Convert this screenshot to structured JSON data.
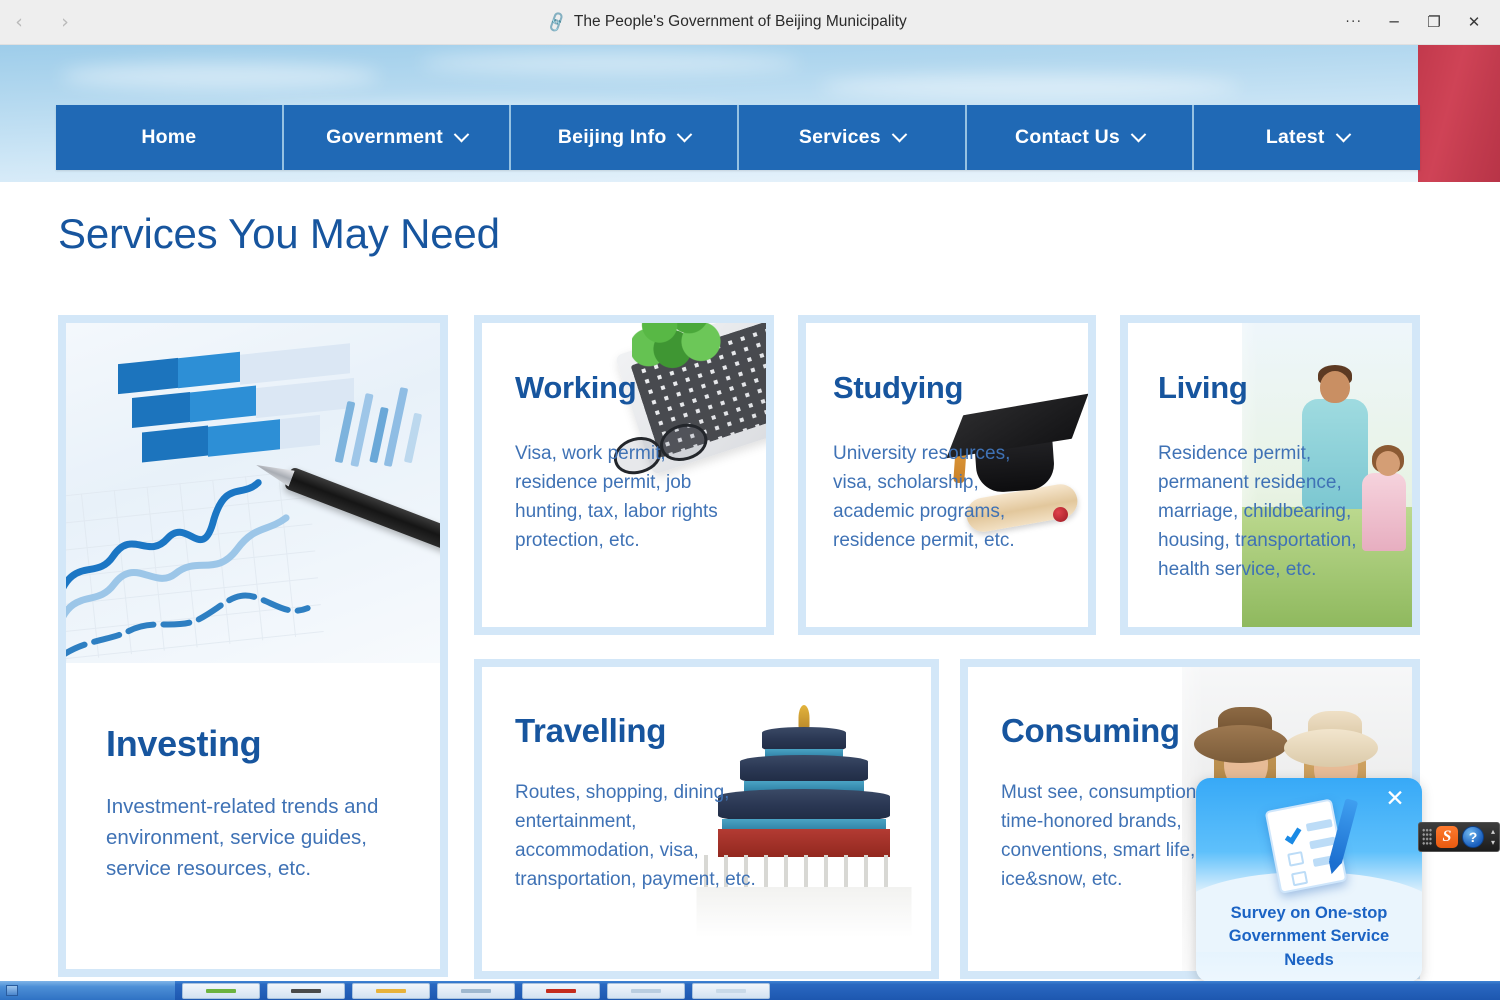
{
  "browser": {
    "title": "The People's Government of Beijing Municipality",
    "back_label": "‹",
    "forward_label": "›",
    "more_label": "···",
    "minimize_label": "─",
    "restore_label": "❐",
    "close_label": "✕",
    "paperclip_icon": "🖇"
  },
  "nav": {
    "items": [
      {
        "label": "Home",
        "has_caret": false
      },
      {
        "label": "Government",
        "has_caret": true
      },
      {
        "label": "Beijing Info",
        "has_caret": true
      },
      {
        "label": "Services",
        "has_caret": true
      },
      {
        "label": "Contact Us",
        "has_caret": true
      },
      {
        "label": "Latest",
        "has_caret": true
      }
    ]
  },
  "page": {
    "section_title": "Services You May Need"
  },
  "cards": [
    {
      "id": "investing",
      "title": "Investing",
      "desc": "Investment-related trends and environment, service guides, service resources, etc."
    },
    {
      "id": "working",
      "title": "Working",
      "desc": "Visa, work permit, residence permit, job hunting, tax, labor rights protection, etc."
    },
    {
      "id": "studying",
      "title": "Studying",
      "desc": "University resources, visa, scholarship, academic programs, residence permit, etc."
    },
    {
      "id": "living",
      "title": "Living",
      "desc": "Residence permit, permanent residence, marriage, childbearing, housing, transportation, health service, etc."
    },
    {
      "id": "travelling",
      "title": "Travelling",
      "desc": "Routes, shopping, dining, entertainment, accommodation, visa, transportation, payment, etc."
    },
    {
      "id": "consuming",
      "title": "Consuming",
      "desc": "Must see, consumption seasons, time-honored brands, conventions, smart life, ice&snow, etc."
    }
  ],
  "survey_popup": {
    "text": "Survey on One-stop Government Service Needs",
    "close_label": "✕"
  },
  "ime": {
    "logo_label": "S",
    "help_label": "?",
    "up_label": "▴",
    "down_label": "▾"
  },
  "taskbar": {
    "buttons": [
      {
        "color": "#6cb33f"
      },
      {
        "color": "#4a4a4a"
      },
      {
        "color": "#e8b23a"
      },
      {
        "color": "#9fb8cf"
      },
      {
        "color": "#c42b1c"
      },
      {
        "color": "#b9cde0"
      },
      {
        "color": "#c9d9e8"
      }
    ]
  },
  "colors": {
    "nav_blue": "#2069b5",
    "title_blue": "#17559e",
    "body_blue": "#3f72b5",
    "card_border": "#d3e7f8",
    "flag_red": "#c2394c"
  }
}
